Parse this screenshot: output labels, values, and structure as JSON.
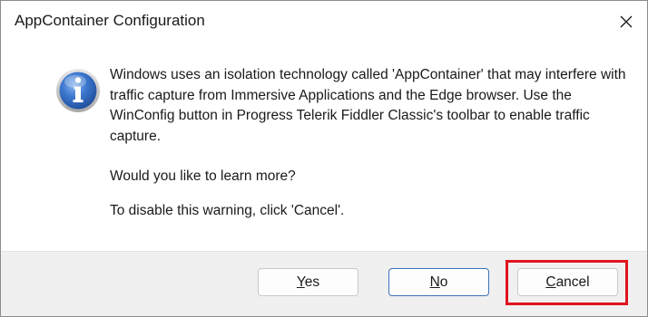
{
  "window": {
    "title": "AppContainer Configuration"
  },
  "message": {
    "main": "Windows uses an isolation technology called 'AppContainer' that may interfere with traffic capture from Immersive Applications and the Edge browser. Use the WinConfig button in Progress Telerik Fiddler Classic's toolbar to enable traffic capture.",
    "question": "Would you like to learn more?",
    "disable_hint": "To disable this warning, click 'Cancel'."
  },
  "buttons": {
    "yes": {
      "mnemonic": "Y",
      "rest": "es"
    },
    "no": {
      "mnemonic": "N",
      "rest": "o"
    },
    "cancel": {
      "mnemonic": "C",
      "rest": "ancel"
    }
  },
  "icons": {
    "info": "information-icon",
    "close": "close-icon"
  },
  "colors": {
    "highlight": "#e0141e",
    "info_icon_blue": "#2a5fb0",
    "default_button_border": "#3d73b8",
    "footer_bg": "#f0f0f0"
  }
}
